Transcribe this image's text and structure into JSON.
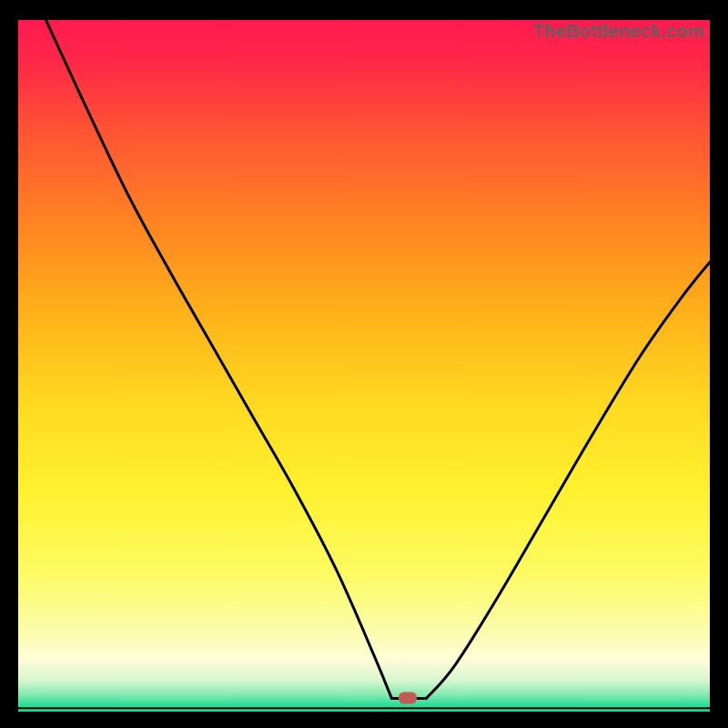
{
  "watermark": "TheBottleneck.com",
  "marker": {
    "color": "#c25a55",
    "x_pct": 56.3,
    "y_pct": 98.05
  },
  "gradient": {
    "stops": [
      {
        "offset": 0.0,
        "color": "#ff1a4f"
      },
      {
        "offset": 0.06,
        "color": "#ff2747"
      },
      {
        "offset": 0.15,
        "color": "#ff4f35"
      },
      {
        "offset": 0.28,
        "color": "#ff7f23"
      },
      {
        "offset": 0.42,
        "color": "#ffb019"
      },
      {
        "offset": 0.55,
        "color": "#ffd820"
      },
      {
        "offset": 0.68,
        "color": "#fff12e"
      },
      {
        "offset": 0.8,
        "color": "#fcfb62"
      },
      {
        "offset": 0.88,
        "color": "#fbfca8"
      },
      {
        "offset": 0.925,
        "color": "#fdfdd8"
      },
      {
        "offset": 0.955,
        "color": "#d7f6cf"
      },
      {
        "offset": 0.975,
        "color": "#88eab2"
      },
      {
        "offset": 0.99,
        "color": "#2be097"
      },
      {
        "offset": 1.0,
        "color": "#14db8f"
      }
    ]
  },
  "chart_data": {
    "type": "line",
    "title": "",
    "xlabel": "",
    "ylabel": "",
    "xlim": [
      0,
      100
    ],
    "ylim": [
      0,
      100
    ],
    "grid": false,
    "series": [
      {
        "name": "left-branch",
        "x": [
          4.0,
          10.0,
          16.0,
          22.0,
          28.0,
          34.0,
          40.0,
          46.0,
          51.5,
          54.0
        ],
        "values": [
          100.0,
          87.0,
          74.5,
          63.5,
          53.0,
          42.5,
          32.0,
          20.5,
          8.0,
          1.9
        ]
      },
      {
        "name": "flat-bottom",
        "x": [
          54.0,
          59.0
        ],
        "values": [
          1.9,
          1.9
        ]
      },
      {
        "name": "right-branch",
        "x": [
          59.0,
          63.0,
          69.0,
          76.0,
          83.0,
          90.0,
          96.0,
          100.0
        ],
        "values": [
          1.9,
          6.5,
          16.0,
          28.0,
          40.0,
          51.5,
          60.0,
          65.0
        ]
      },
      {
        "name": "baseline",
        "x": [
          0.0,
          100.0
        ],
        "values": [
          0.5,
          0.5
        ]
      }
    ]
  }
}
